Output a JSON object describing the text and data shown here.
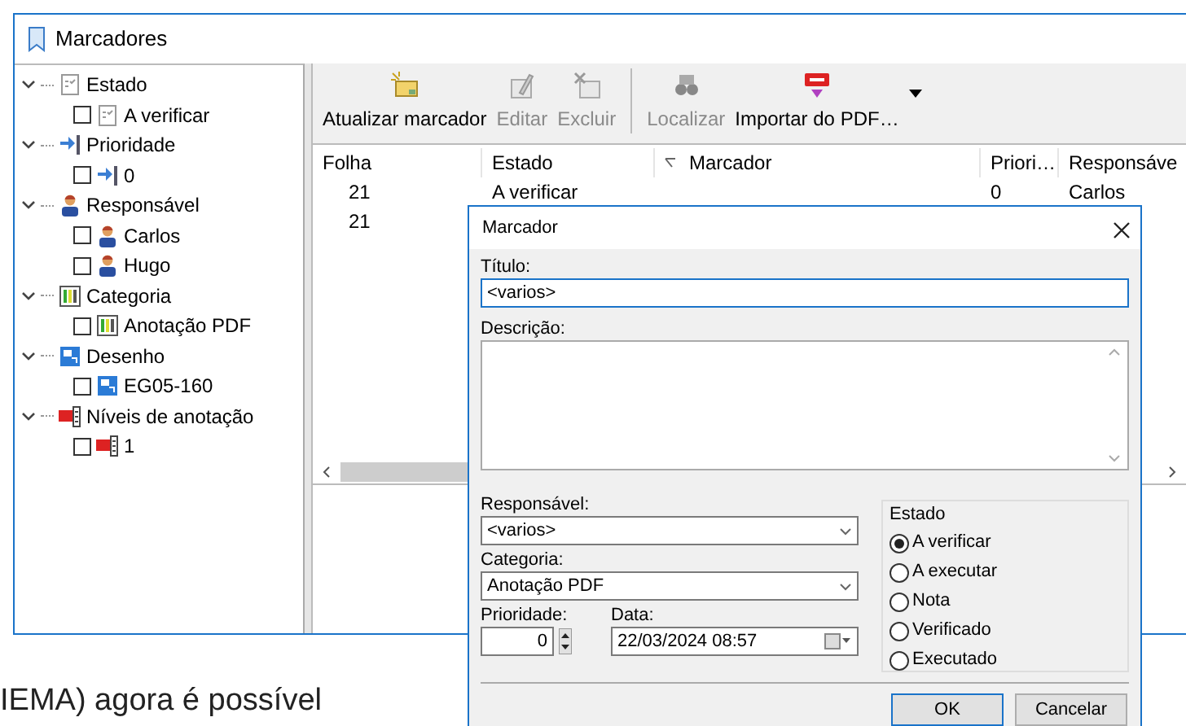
{
  "window": {
    "title": "Marcadores"
  },
  "tree": [
    {
      "label": "Estado",
      "kind": "status",
      "expanded": true,
      "children": [
        {
          "label": "A verificar",
          "kind": "status",
          "checked": false
        }
      ]
    },
    {
      "label": "Prioridade",
      "kind": "priority",
      "expanded": true,
      "children": [
        {
          "label": "0",
          "kind": "priority",
          "checked": false
        }
      ]
    },
    {
      "label": "Responsável",
      "kind": "person",
      "expanded": true,
      "children": [
        {
          "label": "Carlos",
          "kind": "person",
          "checked": false
        },
        {
          "label": "Hugo",
          "kind": "person",
          "checked": false
        }
      ]
    },
    {
      "label": "Categoria",
      "kind": "category",
      "expanded": true,
      "children": [
        {
          "label": "Anotação PDF",
          "kind": "category",
          "checked": false
        }
      ]
    },
    {
      "label": "Desenho",
      "kind": "drawing",
      "expanded": true,
      "children": [
        {
          "label": "EG05-160",
          "kind": "drawing",
          "checked": false
        }
      ]
    },
    {
      "label": "Níveis de anotação",
      "kind": "layer",
      "expanded": true,
      "children": [
        {
          "label": "1",
          "kind": "layer",
          "checked": false
        }
      ]
    }
  ],
  "toolbar": [
    {
      "kind": "update",
      "label": "Atualizar marcador",
      "disabled": false,
      "dropdown": false
    },
    {
      "kind": "edit",
      "label": "Editar",
      "disabled": true,
      "dropdown": false
    },
    {
      "kind": "delete",
      "label": "Excluir",
      "disabled": true,
      "dropdown": false
    },
    {
      "kind": "separator"
    },
    {
      "kind": "locate",
      "label": "Localizar",
      "disabled": true,
      "dropdown": false
    },
    {
      "kind": "pdf",
      "label": "Importar do PDF…",
      "disabled": false,
      "dropdown": true
    }
  ],
  "table": {
    "columns": [
      {
        "label": "Folha",
        "sorted": false
      },
      {
        "label": "Estado",
        "sorted": false
      },
      {
        "label": "Marcador",
        "sorted": true
      },
      {
        "label": "Priori…",
        "sorted": false
      },
      {
        "label": "Responsáve",
        "sorted": false
      }
    ],
    "rows": [
      {
        "folha": "21",
        "estado": "A verificar",
        "prioridade": "0",
        "responsavel": "Carlos"
      },
      {
        "folha": "21"
      }
    ]
  },
  "background_text": "IEMA) agora é possível",
  "dialog": {
    "title": "Marcador",
    "titulo": {
      "label": "Título:",
      "value": "<varios>"
    },
    "descricao": {
      "label": "Descrição:"
    },
    "responsavel": {
      "label": "Responsável:",
      "value": "<varios>"
    },
    "categoria": {
      "label": "Categoria:",
      "value": "Anotação PDF"
    },
    "prioridade": {
      "label": "Prioridade:",
      "value": "0"
    },
    "data": {
      "label": "Data:",
      "value": "22/03/2024 08:57"
    },
    "estado": {
      "label": "Estado",
      "options": [
        {
          "label": "A verificar",
          "selected": true
        },
        {
          "label": "A executar",
          "selected": false
        },
        {
          "label": "Nota",
          "selected": false
        },
        {
          "label": "Verificado",
          "selected": false
        },
        {
          "label": "Executado",
          "selected": false
        }
      ]
    },
    "buttons": [
      {
        "label": "OK",
        "default": true
      },
      {
        "label": "Cancelar",
        "default": false
      }
    ]
  }
}
